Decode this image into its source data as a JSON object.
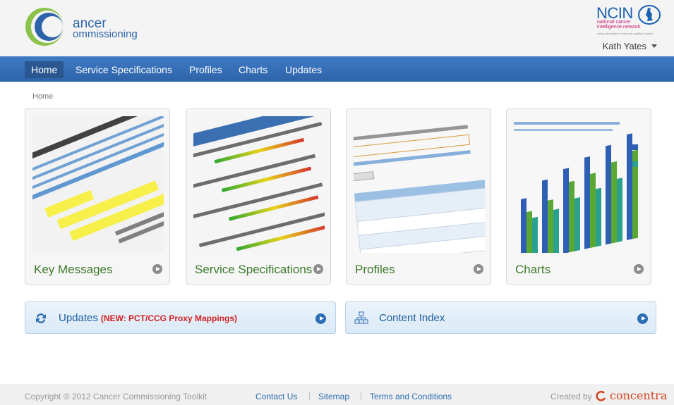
{
  "header": {
    "logo_line1": "ancer",
    "logo_line2": "ommissioning",
    "ncin_title": "NCIN",
    "ncin_subtitle": "national cancer intelligence network",
    "ncin_tagline": "using information to improve quality & choice",
    "user_name": "Kath Yates"
  },
  "nav": {
    "items": [
      {
        "label": "Home",
        "active": true
      },
      {
        "label": "Service Specifications",
        "active": false
      },
      {
        "label": "Profiles",
        "active": false
      },
      {
        "label": "Charts",
        "active": false
      },
      {
        "label": "Updates",
        "active": false
      }
    ]
  },
  "breadcrumb": "Home",
  "cards": [
    {
      "label": "Key Messages"
    },
    {
      "label": "Service Specifications"
    },
    {
      "label": "Profiles"
    },
    {
      "label": "Charts"
    }
  ],
  "updates": {
    "label": "Updates",
    "new_text": "(NEW: PCT/CCG Proxy Mappings)"
  },
  "content_index": {
    "label": "Content Index"
  },
  "footer": {
    "copyright": "Copyright © 2012 Cancer Commissioning Toolkit",
    "contact": "Contact Us",
    "sitemap": "Sitemap",
    "terms": "Terms and Conditions",
    "created_by": "Created by",
    "brand": "concentra"
  },
  "colors": {
    "nav_blue": "#3a73bb",
    "card_label_green": "#3d7a2a",
    "link_blue": "#2d6db3",
    "new_red": "#d12020",
    "brand_orange": "#d2451e"
  }
}
